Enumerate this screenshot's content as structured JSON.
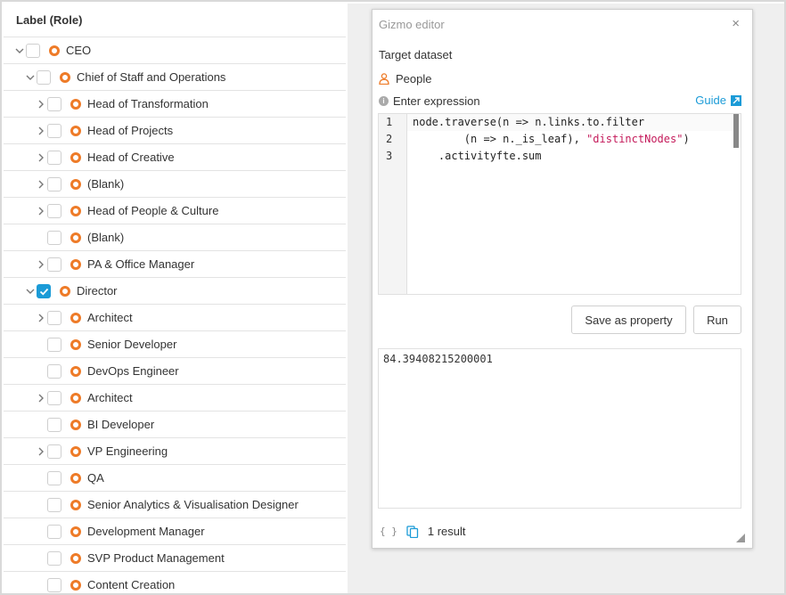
{
  "tree": {
    "header": "Label (Role)",
    "rows": [
      {
        "label": "CEO",
        "level": 0,
        "expand": "expanded",
        "checked": false
      },
      {
        "label": "Chief of Staff and Operations",
        "level": 1,
        "expand": "expanded",
        "checked": false
      },
      {
        "label": "Head of Transformation",
        "level": 2,
        "expand": "collapsed",
        "checked": false
      },
      {
        "label": "Head of Projects",
        "level": 2,
        "expand": "collapsed",
        "checked": false
      },
      {
        "label": "Head of Creative",
        "level": 2,
        "expand": "collapsed",
        "checked": false
      },
      {
        "label": "(Blank)",
        "level": 2,
        "expand": "collapsed",
        "checked": false
      },
      {
        "label": "Head of People & Culture",
        "level": 2,
        "expand": "collapsed",
        "checked": false
      },
      {
        "label": "(Blank)",
        "level": 2,
        "expand": "none",
        "checked": false
      },
      {
        "label": "PA & Office Manager",
        "level": 2,
        "expand": "collapsed",
        "checked": false
      },
      {
        "label": "Director",
        "level": 1,
        "expand": "expanded",
        "checked": true
      },
      {
        "label": "Architect",
        "level": 2,
        "expand": "collapsed",
        "checked": false
      },
      {
        "label": "Senior Developer",
        "level": 2,
        "expand": "none",
        "checked": false
      },
      {
        "label": "DevOps Engineer",
        "level": 2,
        "expand": "none",
        "checked": false
      },
      {
        "label": "Architect",
        "level": 2,
        "expand": "collapsed",
        "checked": false
      },
      {
        "label": "BI Developer",
        "level": 2,
        "expand": "none",
        "checked": false
      },
      {
        "label": "VP Engineering",
        "level": 2,
        "expand": "collapsed",
        "checked": false
      },
      {
        "label": "QA",
        "level": 2,
        "expand": "none",
        "checked": false
      },
      {
        "label": "Senior Analytics & Visualisation Designer",
        "level": 2,
        "expand": "none",
        "checked": false
      },
      {
        "label": "Development Manager",
        "level": 2,
        "expand": "none",
        "checked": false
      },
      {
        "label": "SVP Product Management",
        "level": 2,
        "expand": "none",
        "checked": false
      },
      {
        "label": "Content Creation",
        "level": 2,
        "expand": "none",
        "checked": false
      }
    ]
  },
  "editor": {
    "title": "Gizmo editor",
    "close_label": "×",
    "target_dataset_label": "Target dataset",
    "dataset_name": "People",
    "expression_label": "Enter expression",
    "guide_label": "Guide",
    "code": {
      "line_numbers": [
        "1",
        "2",
        "3"
      ],
      "line1_a": "node.traverse",
      "line1_b": "(n => n.links.to.filter",
      "line2_a": "        (n => n._is_leaf), ",
      "line2_str": "\"distinctNodes\"",
      "line2_b": ")",
      "line3": "    .activityfte.sum"
    },
    "save_as_property_label": "Save as property",
    "run_label": "Run",
    "result_value": "84.39408215200001",
    "braces_label": "{ }",
    "result_count": "1 result"
  },
  "colors": {
    "accent": "#1b9bd7",
    "node_icon": "#ee7b28",
    "person_icon": "#ee7b28",
    "code_string": "#c41a5a"
  }
}
